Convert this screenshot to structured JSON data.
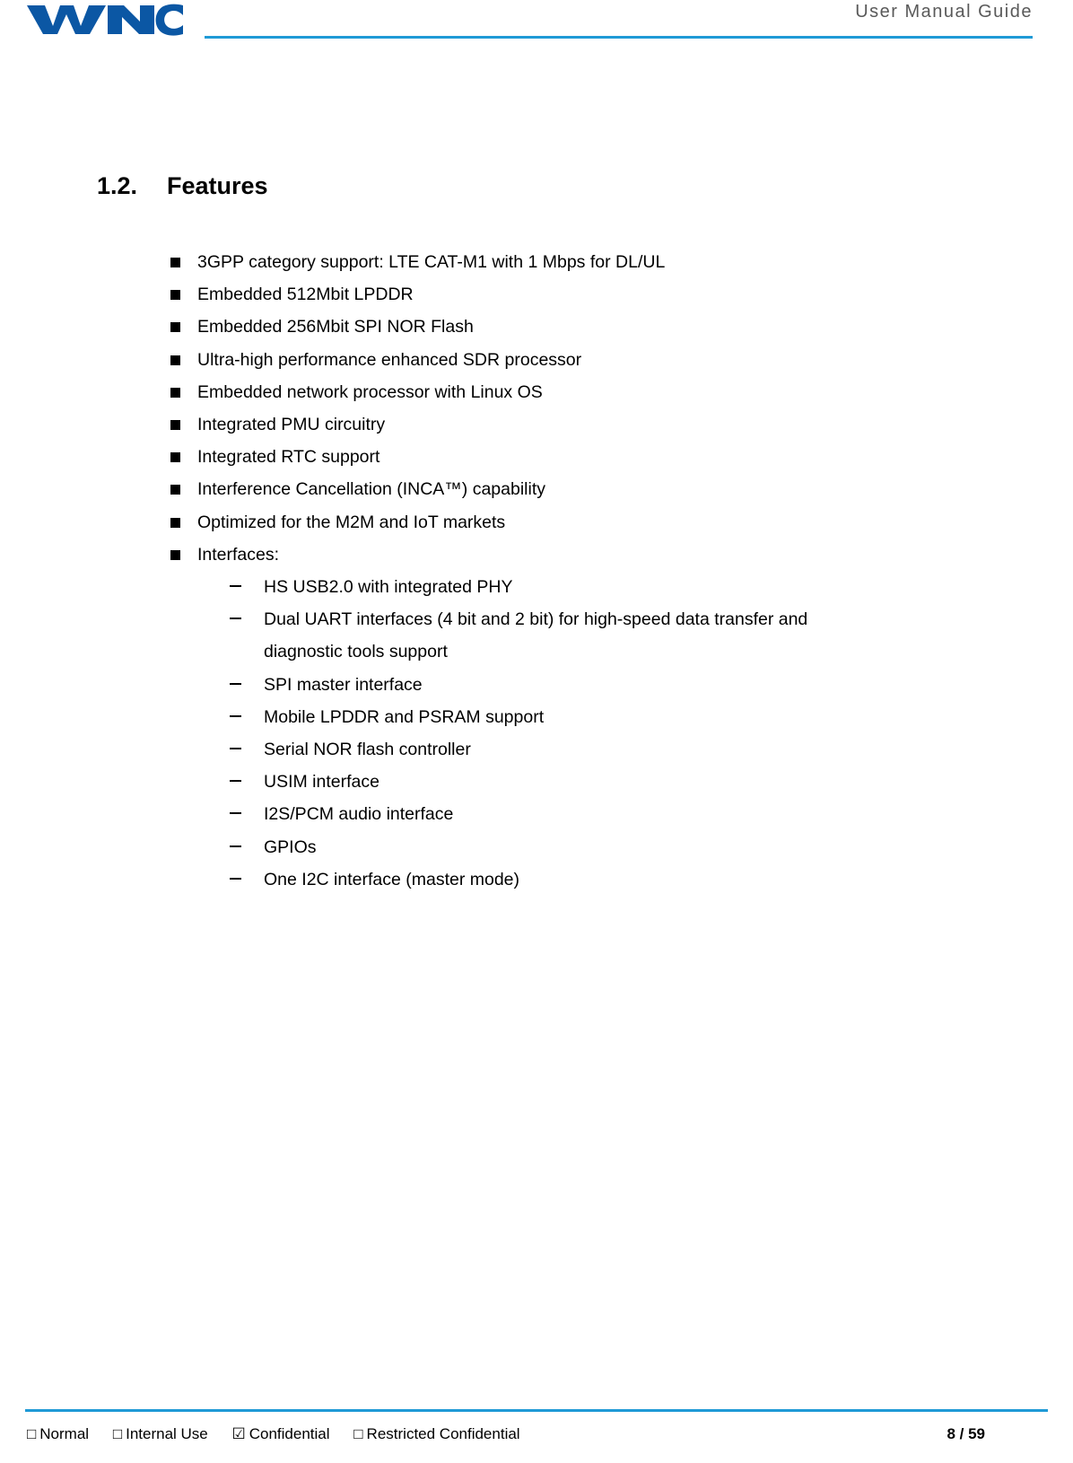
{
  "header": {
    "title": "User  Manual  Guide",
    "logo_text": "WNC",
    "accent_color": "#1f9ad6"
  },
  "section": {
    "number": "1.2.",
    "title": "Features"
  },
  "bullets": [
    "3GPP category support: LTE CAT-M1 with 1 Mbps for DL/UL",
    "Embedded 512Mbit LPDDR",
    "Embedded 256Mbit SPI NOR Flash",
    "Ultra-high performance enhanced SDR processor",
    "Embedded network processor with Linux OS",
    "Integrated PMU circuitry",
    "Integrated RTC support",
    "Interference Cancellation (INCA™) capability",
    "Optimized for the M2M and IoT markets",
    "Interfaces:"
  ],
  "subbullets": [
    {
      "line1": "HS USB2.0 with integrated PHY",
      "line2": ""
    },
    {
      "line1": "Dual UART interfaces (4 bit and 2 bit) for high-speed data transfer and",
      "line2": "diagnostic tools support"
    },
    {
      "line1": "SPI master interface",
      "line2": ""
    },
    {
      "line1": "Mobile LPDDR and PSRAM support",
      "line2": ""
    },
    {
      "line1": "Serial NOR flash controller",
      "line2": ""
    },
    {
      "line1": "USIM interface",
      "line2": ""
    },
    {
      "line1": "I2S/PCM audio interface",
      "line2": ""
    },
    {
      "line1": "GPIOs",
      "line2": ""
    },
    {
      "line1": "One I2C interface (master mode)",
      "line2": ""
    }
  ],
  "footer": {
    "classifications": [
      {
        "box": "□",
        "label": "Normal"
      },
      {
        "box": "□",
        "label": "Internal Use"
      },
      {
        "box": "☑",
        "label": "Confidential"
      },
      {
        "box": "□",
        "label": "Restricted Confidential"
      }
    ],
    "page": "8 / 59"
  }
}
